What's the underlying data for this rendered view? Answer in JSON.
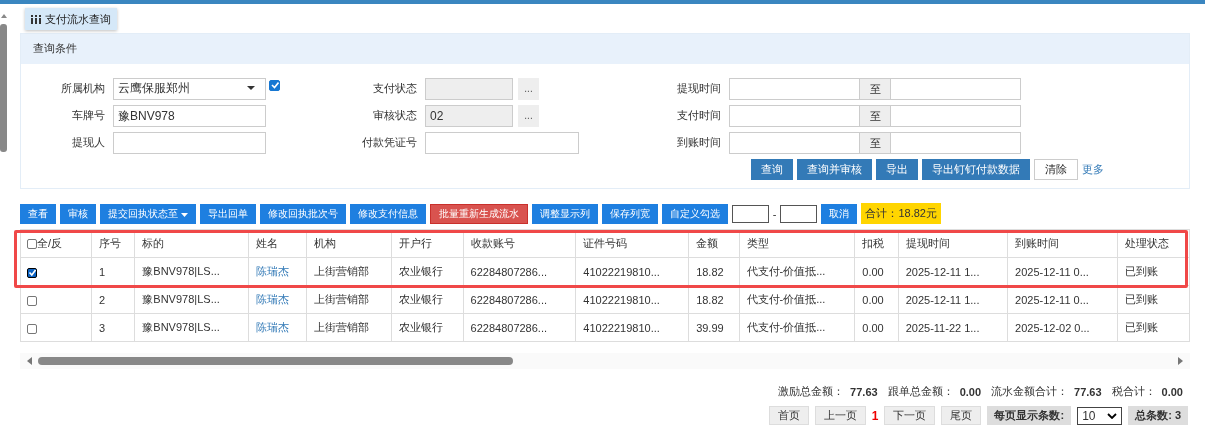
{
  "tab": {
    "label": "支付流水查询"
  },
  "query_panel": {
    "title": "查询条件",
    "rows": [
      [
        {
          "kind": "select",
          "label": "所属机构",
          "value": "云鹰保服郑州",
          "checked": true
        },
        {
          "kind": "picker",
          "label": "支付状态",
          "button": "..."
        },
        {
          "kind": "range",
          "label": "提现时间",
          "separator": "至"
        }
      ],
      [
        {
          "kind": "text",
          "label": "车牌号",
          "value": "豫BNV978"
        },
        {
          "kind": "picker",
          "label": "审核状态",
          "value": "02",
          "button": "..."
        },
        {
          "kind": "range",
          "label": "支付时间",
          "separator": "至"
        }
      ],
      [
        {
          "kind": "text",
          "label": "提现人"
        },
        {
          "kind": "wide",
          "label": "付款凭证号"
        },
        {
          "kind": "range",
          "label": "到账时间",
          "separator": "至"
        }
      ]
    ],
    "buttons": [
      {
        "kind": "primary",
        "label": "查询"
      },
      {
        "kind": "primary",
        "label": "查询并审核"
      },
      {
        "kind": "primary",
        "label": "导出"
      },
      {
        "kind": "primary",
        "label": "导出钉钉付款数据"
      },
      {
        "kind": "plain",
        "label": "清除"
      },
      {
        "kind": "link",
        "label": "更多"
      }
    ]
  },
  "toolbar": [
    {
      "kind": "button",
      "label": "查看"
    },
    {
      "kind": "button",
      "label": "审核"
    },
    {
      "kind": "dropdown",
      "label": "提交回执状态至"
    },
    {
      "kind": "button",
      "label": "导出回单"
    },
    {
      "kind": "button",
      "label": "修改回执批次号"
    },
    {
      "kind": "button",
      "label": "修改支付信息"
    },
    {
      "kind": "danger",
      "label": "批量重新生成流水"
    },
    {
      "kind": "button",
      "label": "调整显示列"
    },
    {
      "kind": "button",
      "label": "保存列宽"
    },
    {
      "kind": "button",
      "label": "自定义勾选"
    },
    {
      "kind": "input"
    },
    {
      "kind": "separator",
      "label": "-"
    },
    {
      "kind": "input"
    },
    {
      "kind": "button",
      "label": "取消"
    },
    {
      "kind": "total",
      "label": "合计：18.82元"
    }
  ],
  "table": {
    "select_all_label": "全/反",
    "select_all_checked": false,
    "columns": [
      {
        "label": "序号",
        "kind": "text"
      },
      {
        "label": "标的",
        "kind": "text"
      },
      {
        "label": "姓名",
        "kind": "link"
      },
      {
        "label": "机构",
        "kind": "text"
      },
      {
        "label": "开户行",
        "kind": "text"
      },
      {
        "label": "收款账号",
        "kind": "text"
      },
      {
        "label": "证件号码",
        "kind": "text"
      },
      {
        "label": "金额",
        "kind": "text"
      },
      {
        "label": "类型",
        "kind": "text"
      },
      {
        "label": "扣税",
        "kind": "text"
      },
      {
        "label": "提现时间",
        "kind": "text"
      },
      {
        "label": "到账时间",
        "kind": "text"
      },
      {
        "label": "处理状态",
        "kind": "text"
      }
    ],
    "rows": [
      {
        "selected": true,
        "cells": [
          "1",
          "豫BNV978|LS...",
          "陈瑞杰",
          "上街营销部",
          "农业银行",
          "62284807286...",
          "41022219810...",
          "18.82",
          "代支付-价值抵...",
          "0.00",
          "2025-12-11 1...",
          "2025-12-11 0...",
          "已到账"
        ]
      },
      {
        "selected": false,
        "cells": [
          "2",
          "豫BNV978|LS...",
          "陈瑞杰",
          "上街营销部",
          "农业银行",
          "62284807286...",
          "41022219810...",
          "18.82",
          "代支付-价值抵...",
          "0.00",
          "2025-12-11 1...",
          "2025-12-11 0...",
          "已到账"
        ]
      },
      {
        "selected": false,
        "cells": [
          "3",
          "豫BNV978|LS...",
          "陈瑞杰",
          "上街营销部",
          "农业银行",
          "62284807286...",
          "41022219810...",
          "39.99",
          "代支付-价值抵...",
          "0.00",
          "2025-11-22 1...",
          "2025-12-02 0...",
          "已到账"
        ]
      }
    ]
  },
  "totals": [
    {
      "label": "激励总金额：",
      "value": "77.63"
    },
    {
      "label": "跟单总金额：",
      "value": "0.00"
    },
    {
      "label": "流水金额合计：",
      "value": "77.63"
    },
    {
      "label": "税合计：",
      "value": "0.00"
    }
  ],
  "pager": {
    "first": "首页",
    "prev": "上一页",
    "current": "1",
    "next": "下一页",
    "last": "尾页",
    "per_page_label": "每页显示条数:",
    "per_page": "10",
    "total": "总条数: 3"
  }
}
